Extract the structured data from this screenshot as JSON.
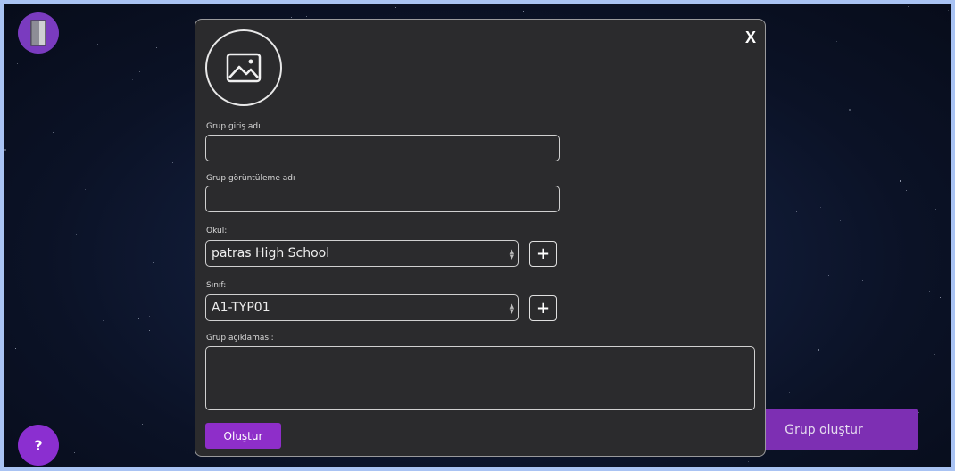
{
  "modal": {
    "close_label": "X",
    "login_name_label": "Grup giriş adı",
    "display_name_label": "Grup görüntüleme adı",
    "school_label": "Okul:",
    "school_value": "patras High School",
    "class_label": "Sınıf:",
    "class_value": "A1-TYP01",
    "description_label": "Grup açıklaması:",
    "add_label": "+",
    "submit_label": "Oluştur"
  },
  "background": {
    "create_group_label": "Grup oluştur",
    "help_label": "?"
  },
  "colors": {
    "accent": "#8e2ec9",
    "modal_bg": "#2b2b2d"
  }
}
